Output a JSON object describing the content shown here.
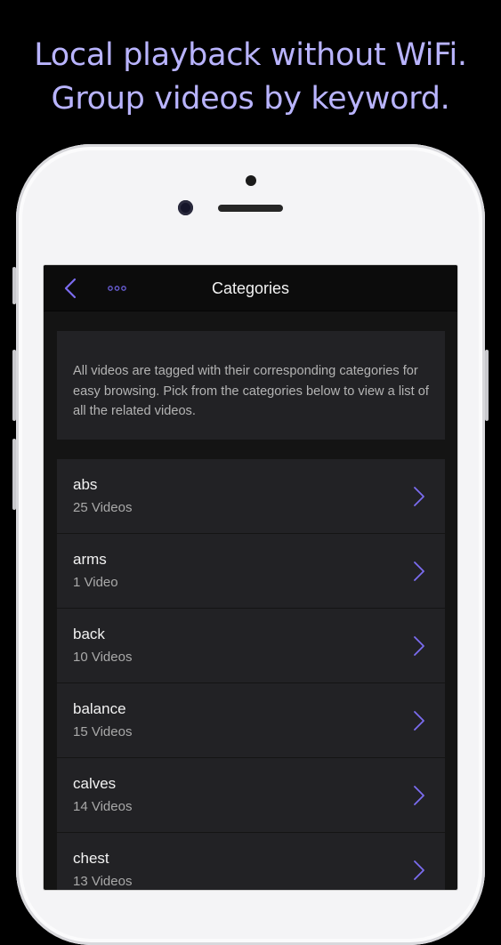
{
  "promo": {
    "line1": "Local playback without WiFi.",
    "line2": "Group videos by keyword."
  },
  "colors": {
    "accent": "#7b6cf0",
    "promo_text": "#b9b4ff",
    "background": "#000000",
    "card": "#222225"
  },
  "navbar": {
    "title": "Categories",
    "back_icon": "chevron-left-icon",
    "more_icon": "ellipsis-icon"
  },
  "intro": {
    "text": "All videos are tagged with their corresponding categories for easy browsing. Pick from the categories below to view a list of all the related videos."
  },
  "categories": [
    {
      "name": "abs",
      "count": "25 Videos"
    },
    {
      "name": "arms",
      "count": "1 Video"
    },
    {
      "name": "back",
      "count": "10 Videos"
    },
    {
      "name": "balance",
      "count": "15 Videos"
    },
    {
      "name": "calves",
      "count": "14 Videos"
    },
    {
      "name": "chest",
      "count": "13 Videos"
    }
  ]
}
